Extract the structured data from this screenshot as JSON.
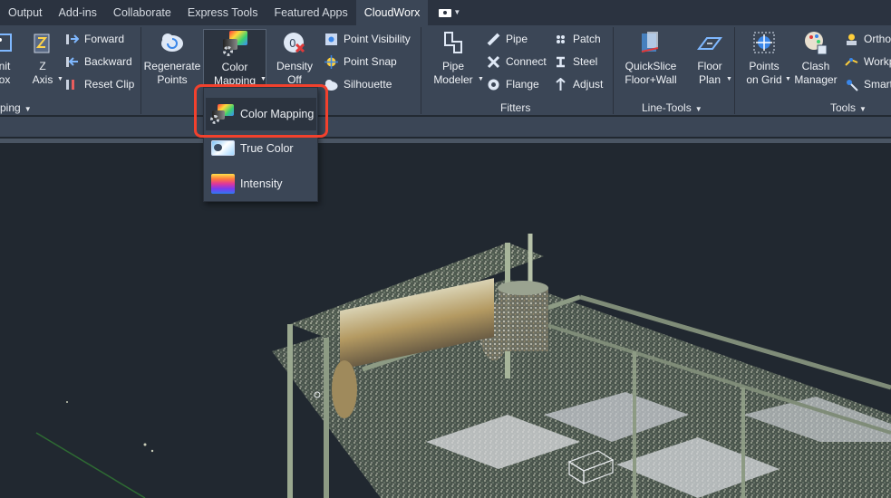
{
  "tabs": [
    "Output",
    "Add-ins",
    "Collaborate",
    "Express Tools",
    "Featured Apps",
    "CloudWorx"
  ],
  "active_tab": "CloudWorx",
  "clipping_panel": {
    "title": "ping",
    "limit_box_label_1": "nit",
    "limit_box_label_2": "ox",
    "z_axis_label_1": "Z",
    "z_axis_label_2": "Axis",
    "forward": "Forward",
    "backward": "Backward",
    "reset_clip": "Reset Clip"
  },
  "points_panel": {
    "regenerate_1": "Regenerate",
    "regenerate_2": "Points",
    "color_mapping_1": "Color",
    "color_mapping_2": "Mapping",
    "density_1": "Density",
    "density_2": "Off",
    "point_visibility": "Point Visibility",
    "point_snap": "Point Snap",
    "silhouette": "Silhouette"
  },
  "fitters_panel": {
    "title": "Fitters",
    "pipe_modeler_1": "Pipe",
    "pipe_modeler_2": "Modeler",
    "pipe": "Pipe",
    "connect": "Connect",
    "flange": "Flange",
    "patch": "Patch",
    "steel": "Steel",
    "adjust": "Adjust"
  },
  "line_tools_panel": {
    "title": "Line-Tools",
    "quickslice_1": "QuickSlice",
    "quickslice_2": "Floor+Wall",
    "floor_plan_1": "Floor",
    "floor_plan_2": "Plan"
  },
  "tools_panel": {
    "title": "Tools",
    "points_grid_1": "Points",
    "points_grid_2": "on Grid",
    "clash_1": "Clash",
    "clash_2": "Manager",
    "ortho": "Ortho",
    "workp": "Workp",
    "smart": "Smart"
  },
  "color_menu": {
    "items": [
      "Color Mapping",
      "True Color",
      "Intensity"
    ],
    "highlighted": "Color Mapping"
  },
  "colors": {
    "ribbon_bg": "#3b4656",
    "tab_bar_bg": "#2b3340",
    "viewport_bg": "#212830",
    "highlight_border": "#f2412d"
  }
}
